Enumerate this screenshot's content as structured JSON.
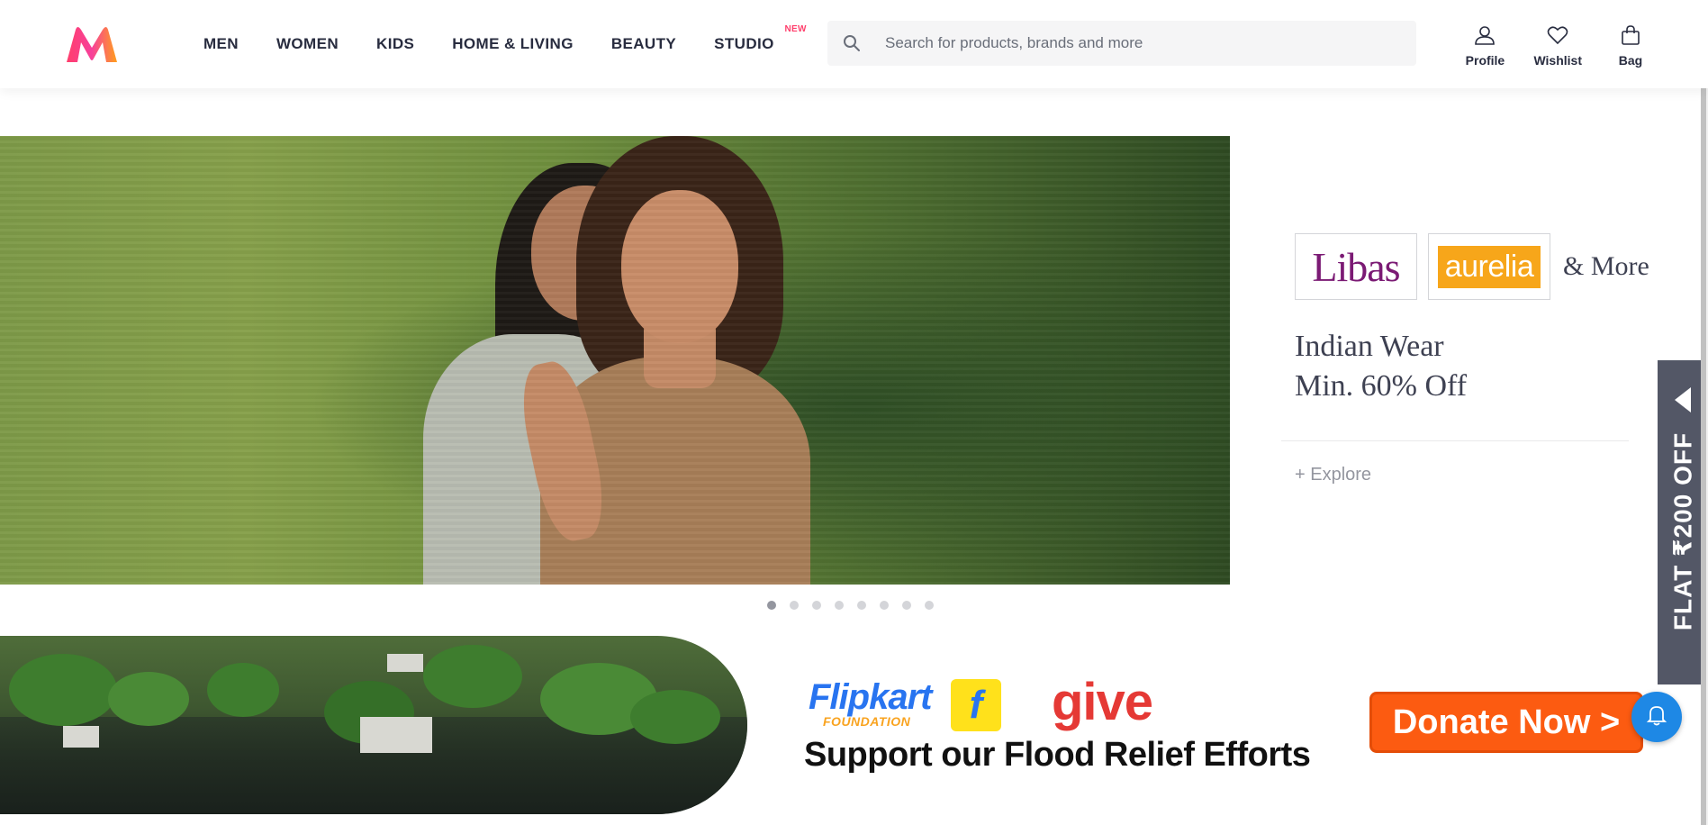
{
  "header": {
    "nav": [
      {
        "label": "MEN"
      },
      {
        "label": "WOMEN"
      },
      {
        "label": "KIDS"
      },
      {
        "label": "HOME & LIVING"
      },
      {
        "label": "BEAUTY"
      },
      {
        "label": "STUDIO",
        "badge": "NEW"
      }
    ],
    "search": {
      "placeholder": "Search for products, brands and more",
      "icon": "search-icon"
    },
    "actions": [
      {
        "label": "Profile",
        "icon": "user-icon"
      },
      {
        "label": "Wishlist",
        "icon": "heart-icon"
      },
      {
        "label": "Bag",
        "icon": "bag-icon"
      }
    ],
    "colors": {
      "brand_pink": "#ff3f6c",
      "brand_orange": "#f7a61a"
    }
  },
  "hero": {
    "brands": [
      "Libas",
      "aurelia"
    ],
    "brands_more": "& More",
    "title_line1": "Indian Wear",
    "title_line2": "Min. 60% Off",
    "explore": "+ Explore",
    "carousel": {
      "total": 8,
      "active": 1
    }
  },
  "side_tab": {
    "label": "FLAT ₹200 OFF"
  },
  "flood_banner": {
    "flipkart": "Flipkart",
    "foundation": "FOUNDATION",
    "bag_letter": "f",
    "give": "give",
    "title": "Support our Flood Relief Efforts",
    "donate_label": "Donate Now >",
    "colors": {
      "donate": "#fc5b11",
      "give": "#e53935",
      "flipkart_blue": "#2874f0"
    }
  },
  "notification": {
    "icon": "bell-icon"
  }
}
